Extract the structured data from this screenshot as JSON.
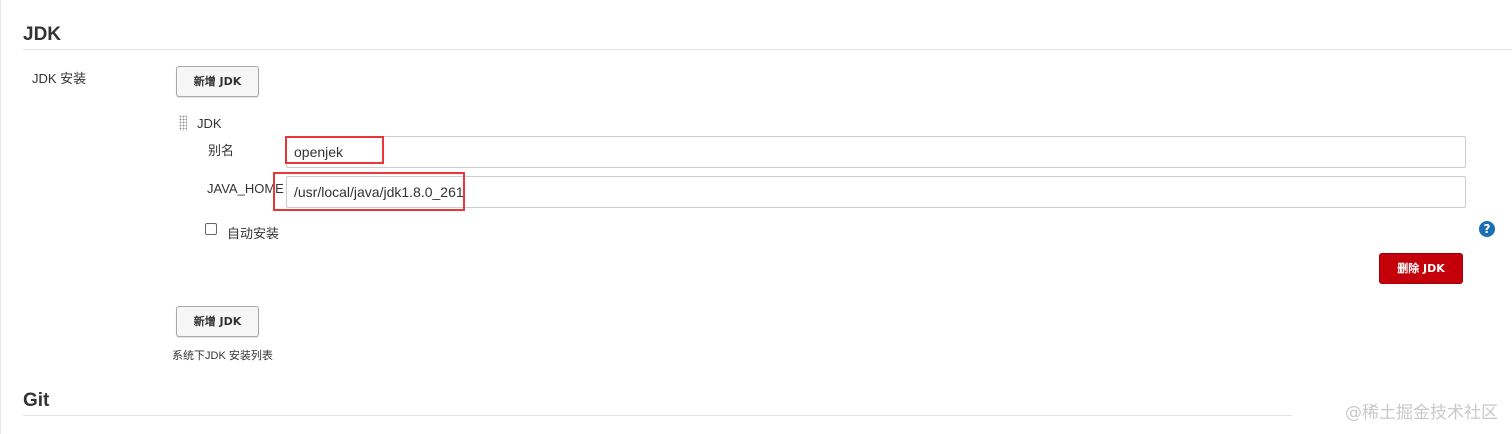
{
  "sections": {
    "jdk_title": "JDK",
    "git_title": "Git"
  },
  "jdk_install": {
    "label": "JDK 安装",
    "add_button_top": "新增 JDK",
    "item": {
      "header": "JDK",
      "alias_label": "别名",
      "alias_value": "openjek",
      "java_home_label": "JAVA_HOME",
      "java_home_value": "/usr/local/java/jdk1.8.0_261",
      "auto_install_label": "自动安装",
      "auto_install_checked": false,
      "help_icon": "question-icon",
      "delete_button": "删除 JDK"
    },
    "add_button_bottom": "新增 JDK",
    "description": "系统下JDK 安装列表"
  },
  "watermark": "@稀土掘金技术社区",
  "colors": {
    "danger": "#c4000a",
    "highlight": "#e8363a",
    "help": "#1a6fb4"
  }
}
